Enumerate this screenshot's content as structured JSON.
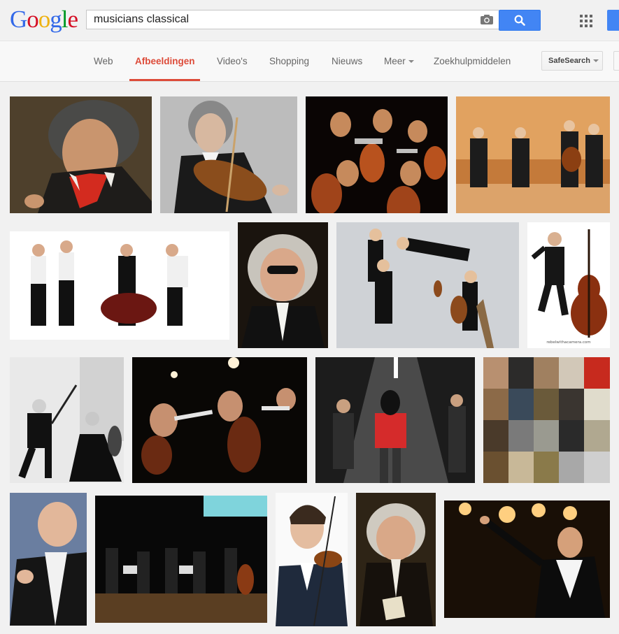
{
  "logo": {
    "letters": [
      "G",
      "o",
      "o",
      "g",
      "l",
      "e"
    ],
    "colors": [
      "#3369e8",
      "#d50f25",
      "#eeb211",
      "#3369e8",
      "#009925",
      "#d50f25"
    ]
  },
  "search": {
    "query": "musicians classical"
  },
  "tabs": [
    {
      "label": "Web"
    },
    {
      "label": "Afbeeldingen"
    },
    {
      "label": "Video's"
    },
    {
      "label": "Shopping"
    },
    {
      "label": "Nieuws"
    },
    {
      "label": "Meer"
    },
    {
      "label": "Zoekhulpmiddelen"
    }
  ],
  "safesearch_label": "SafeSearch",
  "colors": {
    "accent": "#dd4b39",
    "search_button": "#4285f4"
  },
  "images": [
    {
      "alt": "Beethoven portrait"
    },
    {
      "alt": "violinist with viola"
    },
    {
      "alt": "orchestra string section"
    },
    {
      "alt": "string quartet on stage"
    },
    {
      "alt": "cellists dragging cello"
    },
    {
      "alt": "Bach with sunglasses"
    },
    {
      "alt": "musicians floating"
    },
    {
      "alt": "double bass player jumping"
    },
    {
      "alt": "violinist and cellist"
    },
    {
      "alt": "orchestra in dark"
    },
    {
      "alt": "violinist in subway"
    },
    {
      "alt": "composer portraits collage"
    },
    {
      "alt": "conductor"
    },
    {
      "alt": "chamber orchestra on stage"
    },
    {
      "alt": "young violinist"
    },
    {
      "alt": "Bach portrait"
    },
    {
      "alt": "conductor with baton"
    }
  ],
  "image_captions": {
    "bass_player": "rebelwithacamera.com"
  }
}
